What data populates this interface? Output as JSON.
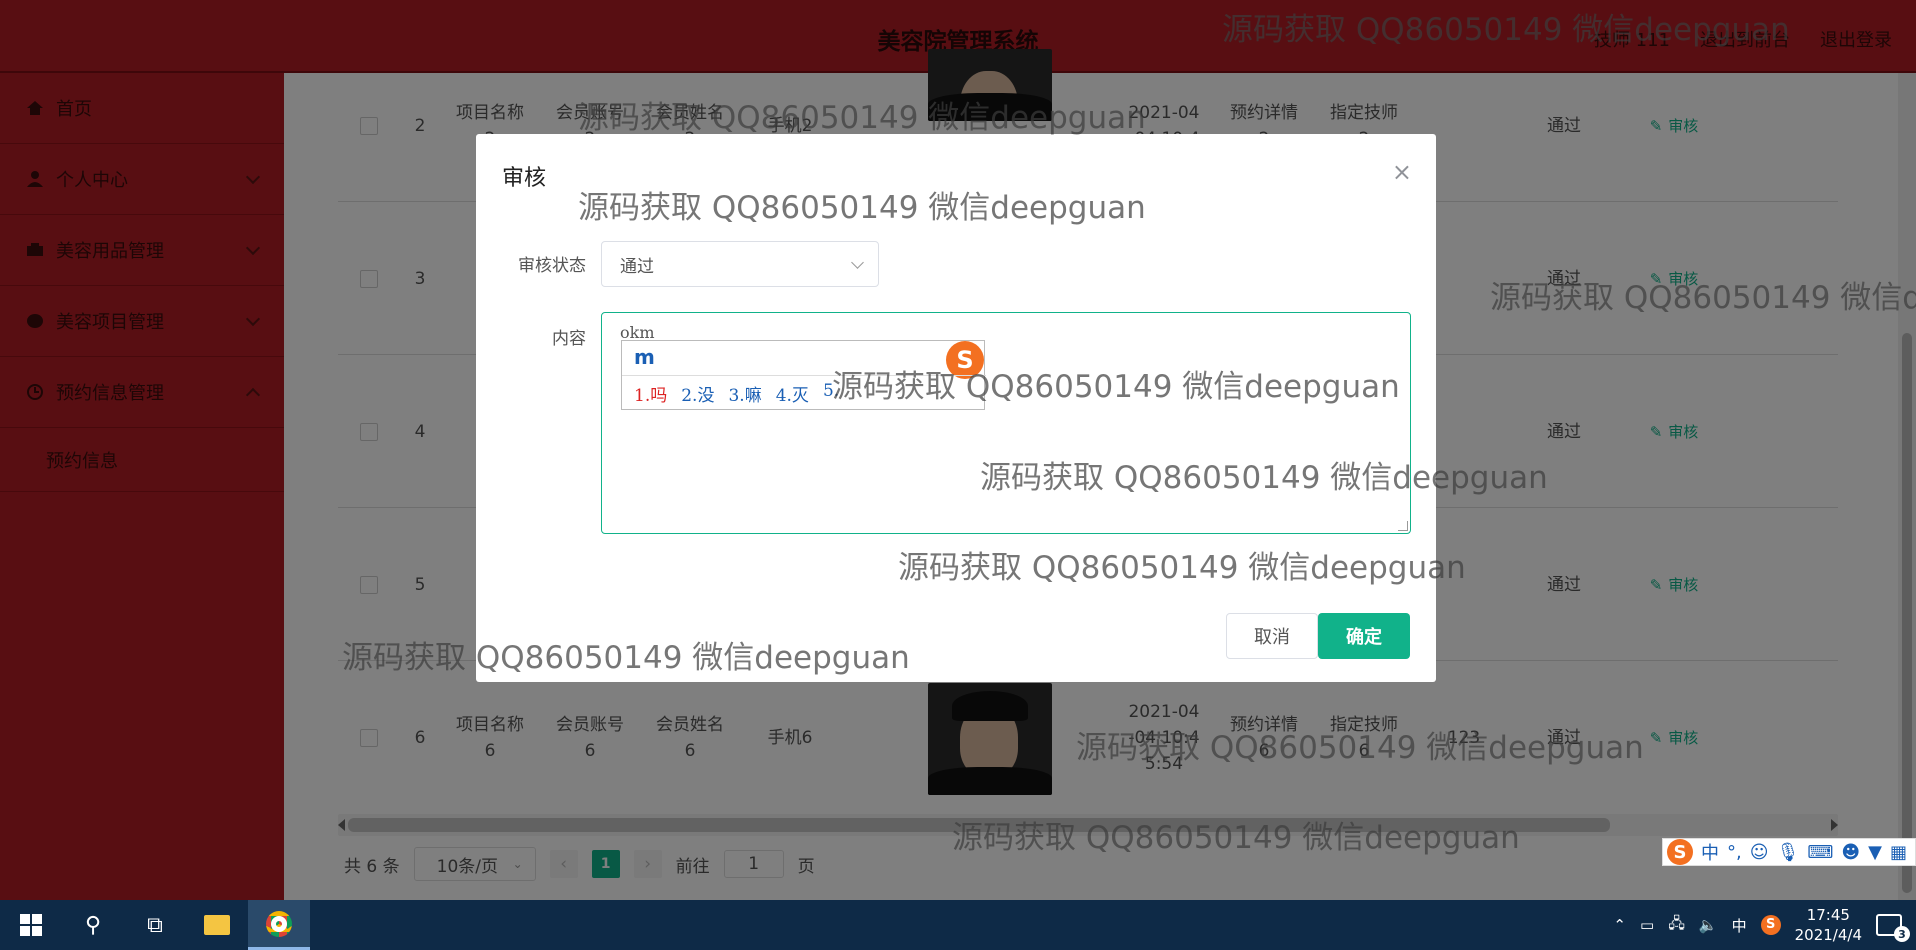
{
  "header": {
    "title": "美容院管理系统",
    "links": [
      "技师 111",
      "退出到前台",
      "退出登录"
    ]
  },
  "sidebar": {
    "items": [
      {
        "label": "首页",
        "icon": "home-icon"
      },
      {
        "label": "个人中心",
        "icon": "user-icon"
      },
      {
        "label": "美容用品管理",
        "icon": "goods-icon"
      },
      {
        "label": "美容项目管理",
        "icon": "project-icon"
      },
      {
        "label": "预约信息管理",
        "icon": "clock-icon"
      }
    ],
    "sub_item": "预约信息"
  },
  "table": {
    "rows": [
      {
        "no": "2",
        "project": "项目名称\n2",
        "account": "会员账号\n2",
        "name": "会员姓名\n2",
        "phone": "手机2",
        "date": "2021-04\n-04 10:4",
        "detail": "预约详情\n2",
        "tech": "指定技师\n2",
        "status": "通过",
        "action": "审核"
      },
      {
        "no": "3",
        "status": "通过",
        "action": "审核"
      },
      {
        "no": "4",
        "status": "通过",
        "action": "审核"
      },
      {
        "no": "5",
        "status": "通过",
        "action": "审核"
      },
      {
        "no": "6",
        "project": "项目名称\n6",
        "account": "会员账号\n6",
        "name": "会员姓名\n6",
        "phone": "手机6",
        "date": "2021-04\n-04 10:4\n5:54",
        "detail": "预约详情\n6",
        "tech": "指定技师\n6",
        "extra": "123",
        "status": "通过",
        "action": "审核"
      }
    ]
  },
  "pager": {
    "total": "共 6 条",
    "size": "10条/页",
    "current": "1",
    "goto_label": "前往",
    "goto_value": "1",
    "page_suffix": "页"
  },
  "dialog": {
    "title": "审核",
    "status_label": "审核状态",
    "status_value": "通过",
    "content_label": "内容",
    "content_value": "okm",
    "ime_typed": "m",
    "ime_candidates": [
      "1.吗",
      "2.没",
      "3.嘛",
      "4.灭",
      "5."
    ],
    "cancel": "取消",
    "confirm": "确定"
  },
  "watermark": "源码获取 QQ86050149 微信deepguan",
  "taskbar": {
    "time": "17:45",
    "date": "2021/4/4",
    "ime_mode": "中",
    "notifications": "3"
  },
  "colors": {
    "brand_red": "#b11c24",
    "accent_green": "#11b28a"
  }
}
